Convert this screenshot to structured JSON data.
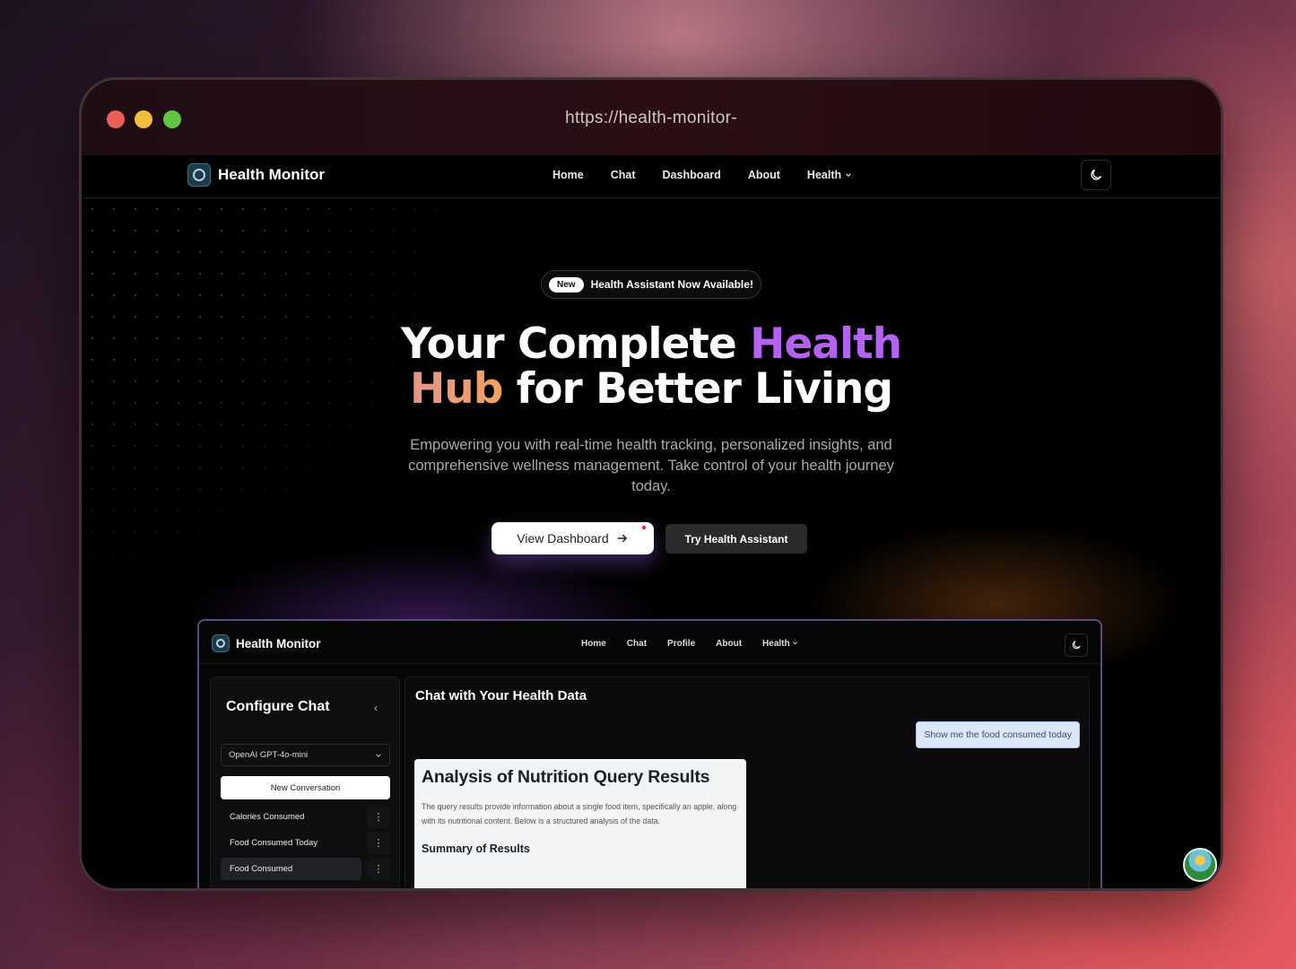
{
  "browser": {
    "url": "https://health-monitor-"
  },
  "site": {
    "brand": "Health Monitor",
    "nav": [
      "Home",
      "Chat",
      "Dashboard",
      "About",
      "Health"
    ],
    "theme_icon": "moon-icon"
  },
  "hero": {
    "badge": "New",
    "announcement": "Health Assistant Now Available!",
    "title_part1": "Your Complete ",
    "title_highlight1": "Health",
    "title_highlight2": "Hub",
    "title_part2": " for Better Living",
    "subtitle": "Empowering you with real-time health tracking, personalized insights, and comprehensive wellness management. Take control of your health journey today.",
    "primary_button": "View Dashboard",
    "secondary_button": "Try Health Assistant",
    "accent_purple": "#b362f2",
    "accent_orange": "#f0a360"
  },
  "preview": {
    "brand": "Health Monitor",
    "nav": [
      "Home",
      "Chat",
      "Profile",
      "About",
      "Health"
    ],
    "sidebar": {
      "title": "Configure Chat",
      "model": "OpenAI GPT-4o-mini",
      "new_conversation": "New Conversation",
      "conversations": [
        "Calories Consumed",
        "Food Consumed Today",
        "Food Consumed"
      ]
    },
    "chat": {
      "title": "Chat with Your Health Data",
      "user_message": "Show me the food consumed today",
      "answer_title": "Analysis of Nutrition Query Results",
      "answer_body": "The query results provide information about a single food item, specifically an apple, along with its nutritional content. Below is a structured analysis of the data.",
      "answer_subtitle": "Summary of Results"
    }
  }
}
